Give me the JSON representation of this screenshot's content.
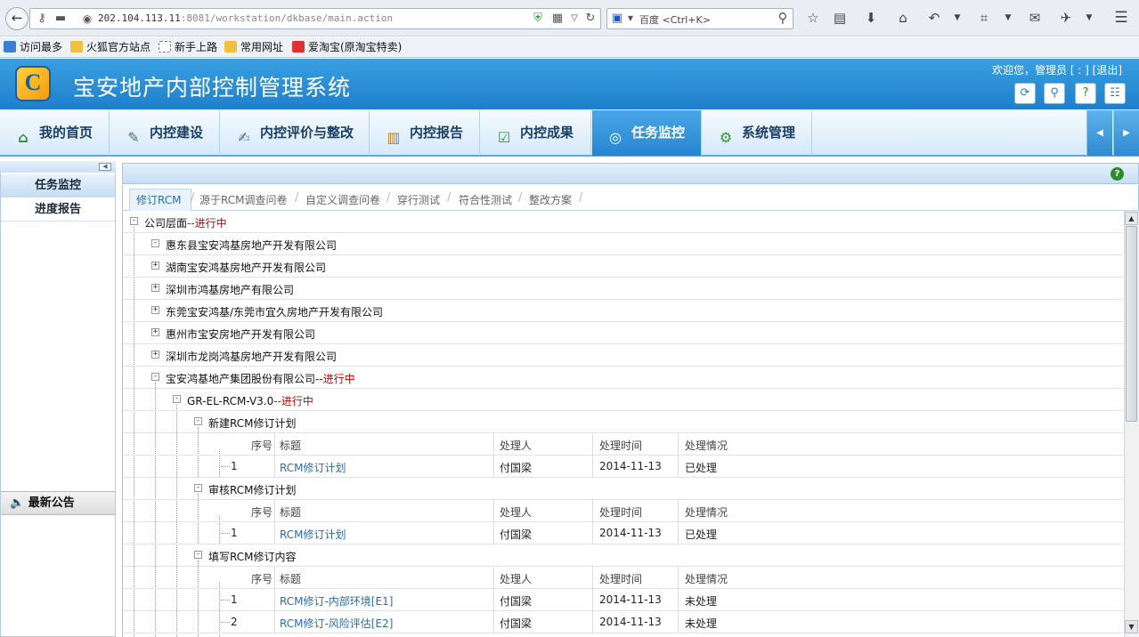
{
  "browser": {
    "url_host": "202.104.113.11",
    "url_rest": ":8081/workstation/dkbase/main.action",
    "search_placeholder": "百度 <Ctrl+K>"
  },
  "bookmarks": [
    "访问最多",
    "火狐官方站点",
    "新手上路",
    "常用网址",
    "爱淘宝(原淘宝特卖)"
  ],
  "app": {
    "title": "宝安地产内部控制管理系统",
    "welcome": "欢迎您，管理员 [ : ] [退出]",
    "logo_letter": "C"
  },
  "main_nav": [
    "我的首页",
    "内控建设",
    "内控评价与整改",
    "内控报告",
    "内控成果",
    "任务监控",
    "系统管理"
  ],
  "sidebar": {
    "items": [
      "任务监控",
      "进度报告"
    ],
    "notice": "最新公告"
  },
  "tabs": [
    "修订RCM",
    "源于RCM调查问卷",
    "自定义调查问卷",
    "穿行测试",
    "符合性测试",
    "整改方案"
  ],
  "tree": {
    "root": "公司层面",
    "root_status": "--进行中",
    "companies": [
      {
        "name": "惠东县宝安鸿基房地产开发有限公司",
        "toggle": "⊟"
      },
      {
        "name": "湖南宝安鸿基房地产开发有限公司",
        "toggle": "⊞"
      },
      {
        "name": "深圳市鸿基房地产有限公司",
        "toggle": "⊞"
      },
      {
        "name": "东莞宝安鸿基/东莞市宜久房地产开发有限公司",
        "toggle": "⊞"
      },
      {
        "name": "惠州市宝安房地产开发有限公司",
        "toggle": "⊞"
      },
      {
        "name": "深圳市龙岗鸿基房地产开发有限公司",
        "toggle": "⊞"
      }
    ],
    "group": {
      "name": "宝安鸿基地产集团股份有限公司",
      "status": "--进行中"
    },
    "rcm": {
      "name": "GR-EL-RCM-V3.0",
      "status": "--进行中"
    },
    "columns": [
      "序号",
      "标题",
      "处理人",
      "处理时间",
      "处理情况"
    ],
    "sections": [
      {
        "name": "新建RCM修订计划",
        "rows": [
          {
            "no": "1",
            "title": "RCM修订计划",
            "person": "付国梁",
            "time": "2014-11-13",
            "status": "已处理"
          }
        ]
      },
      {
        "name": "审核RCM修订计划",
        "rows": [
          {
            "no": "1",
            "title": "RCM修订计划",
            "person": "付国梁",
            "time": "2014-11-13",
            "status": "已处理"
          }
        ]
      },
      {
        "name": "填写RCM修订内容",
        "rows": [
          {
            "no": "1",
            "title": "RCM修订-内部环境[E1]",
            "person": "付国梁",
            "time": "2014-11-13",
            "status": "未处理"
          },
          {
            "no": "2",
            "title": "RCM修订-风险评估[E2]",
            "person": "付国梁",
            "time": "2014-11-13",
            "status": "未处理"
          }
        ]
      }
    ]
  },
  "colors": {
    "header": "#1f7fcc",
    "pending": "#cc0000",
    "link": "#2d6da3"
  }
}
